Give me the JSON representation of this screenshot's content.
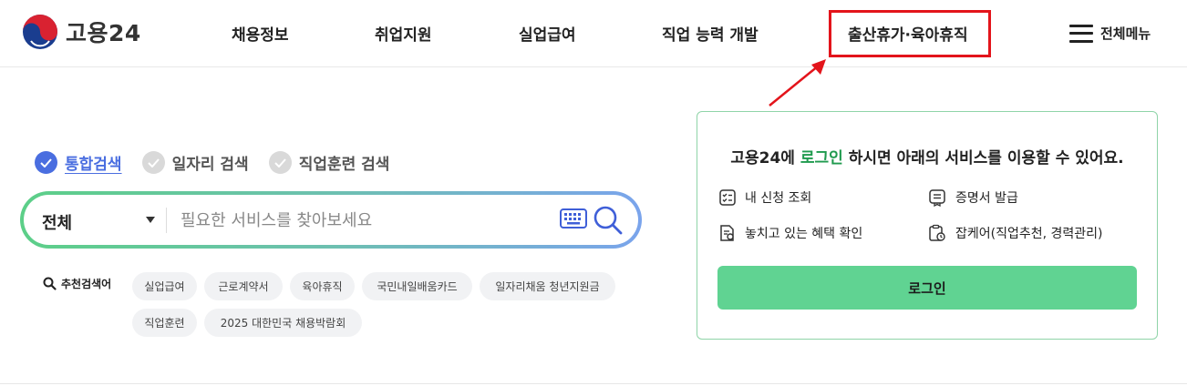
{
  "header": {
    "logo_text": "고용24",
    "nav": [
      "채용정보",
      "취업지원",
      "실업급여",
      "직업 능력 개발",
      "출산휴가·육아휴직"
    ],
    "all_menu_label": "전체메뉴"
  },
  "search": {
    "tabs": [
      "통합검색",
      "일자리 검색",
      "직업훈련 검색"
    ],
    "active_tab": "통합검색",
    "scope_label": "전체",
    "placeholder": "필요한 서비스를 찾아보세요",
    "recommended_label": "추천검색어",
    "recommended": [
      "실업급여",
      "근로계약서",
      "육아휴직",
      "국민내일배움카드",
      "일자리채움 청년지원금",
      "직업훈련",
      "2025 대한민국 채용박람회"
    ]
  },
  "login_panel": {
    "title_prefix": "고용24에 ",
    "title_highlight": "로그인",
    "title_suffix": " 하시면 아래의 서비스를 이용할 수 있어요.",
    "services": [
      "내 신청 조회",
      "증명서 발급",
      "놓치고 있는 혜택 확인",
      "잡케어(직업추천, 경력관리)"
    ],
    "login_button": "로그인"
  },
  "colors": {
    "highlight_box": "#e3141b",
    "active_tab": "#4a6ee0",
    "login_highlight": "#1f9a4e",
    "login_button": "#60d392",
    "panel_border": "#8fd4a8"
  }
}
